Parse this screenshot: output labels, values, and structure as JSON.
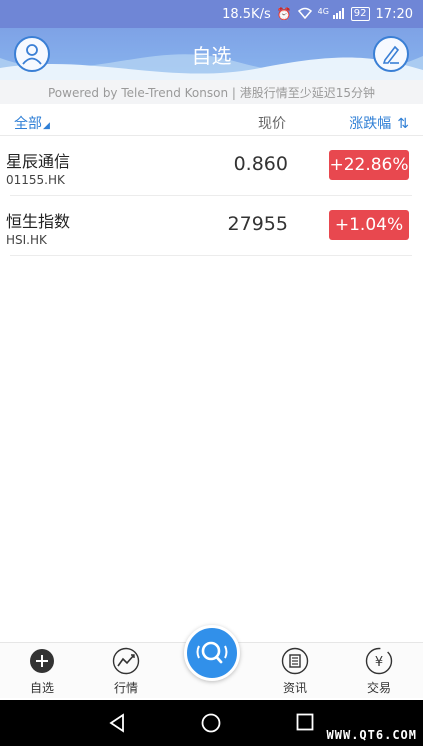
{
  "status_bar": {
    "speed": "18.5K/s",
    "network": "4G",
    "battery": "92",
    "time": "17:20",
    "icons": [
      "alarm-icon",
      "wifi-icon",
      "signal-icon",
      "battery-icon"
    ]
  },
  "header": {
    "title": "自选",
    "left_icon": "profile-icon",
    "right_icon": "edit-icon"
  },
  "notice": {
    "text": "Powered by Tele-Trend Konson | 港股行情至少延迟15分钟"
  },
  "list_header": {
    "filter_label": "全部",
    "price_label": "现价",
    "change_label": "涨跌幅"
  },
  "stocks": [
    {
      "name": "星辰通信",
      "code": "01155.HK",
      "price": "0.860",
      "change": "+22.86%"
    },
    {
      "name": "恒生指数",
      "code": "HSI.HK",
      "price": "27955",
      "change": "+1.04%"
    }
  ],
  "bottom_nav": {
    "items": [
      {
        "label": "自选",
        "icon": "plus-icon"
      },
      {
        "label": "行情",
        "icon": "trend-icon"
      },
      {
        "label": "",
        "icon": "search-icon"
      },
      {
        "label": "资讯",
        "icon": "news-icon"
      },
      {
        "label": "交易",
        "icon": "yuan-icon"
      }
    ]
  },
  "colors": {
    "accent": "#2f7fd6",
    "header_bg": "#7ea2e6",
    "up_badge": "#e8484f",
    "fab": "#3190ea"
  },
  "watermark": "WWW.QT6.COM"
}
